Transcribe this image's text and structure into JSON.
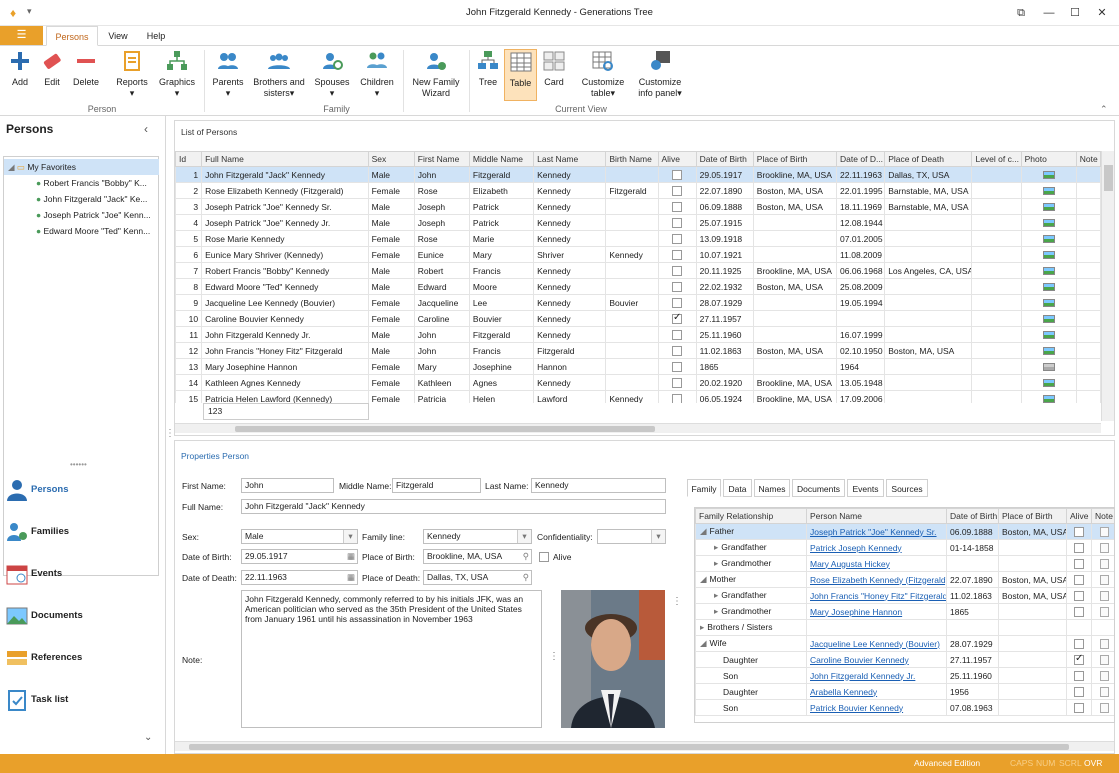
{
  "window": {
    "title": "John Fitzgerald Kennedy - Generations Tree"
  },
  "ribbon_tabs": [
    "Persons",
    "View",
    "Help"
  ],
  "ribbon": {
    "buttons": [
      {
        "label": "Add",
        "icon": "plus-icon"
      },
      {
        "label": "Edit",
        "icon": "eraser-icon"
      },
      {
        "label": "Delete",
        "icon": "minus-icon"
      },
      {
        "label": "Reports",
        "icon": "report-icon"
      },
      {
        "label": "Graphics",
        "icon": "graphics-icon"
      },
      {
        "label": "Parents",
        "icon": "parents-icon"
      },
      {
        "label": "Brothers and sisters",
        "icon": "siblings-icon"
      },
      {
        "label": "Spouses",
        "icon": "spouses-icon"
      },
      {
        "label": "Children",
        "icon": "children-icon"
      },
      {
        "label": "New Family Wizard",
        "icon": "wizard-icon"
      },
      {
        "label": "Tree",
        "icon": "tree-icon"
      },
      {
        "label": "Table",
        "icon": "table-icon"
      },
      {
        "label": "Card",
        "icon": "card-icon"
      },
      {
        "label": "Customize table",
        "icon": "customize-table-icon"
      },
      {
        "label": "Customize info panel",
        "icon": "customize-panel-icon"
      }
    ],
    "groups": [
      "Person",
      "Family",
      "Current View"
    ]
  },
  "left": {
    "title": "Persons",
    "favorites_label": "My Favorites",
    "favorites": [
      "Robert Francis \"Bobby\" K...",
      "John Fitzgerald \"Jack\" Ke...",
      "Joseph Patrick \"Joe\" Kenn...",
      "Edward Moore \"Ted\" Kenn..."
    ],
    "nav": [
      "Persons",
      "Families",
      "Events",
      "Documents",
      "References",
      "Task list"
    ]
  },
  "list": {
    "title": "List of Persons",
    "columns": [
      "Id",
      "Full Name",
      "Sex",
      "First Name",
      "Middle Name",
      "Last Name",
      "Birth Name",
      "Alive",
      "Date of Birth",
      "Place of Birth",
      "Date of D...",
      "Place of Death",
      "Level of c...",
      "Photo",
      "Note"
    ],
    "rows": [
      [
        "1",
        "John Fitzgerald \"Jack\" Kennedy",
        "Male",
        "John",
        "Fitzgerald",
        "Kennedy",
        "",
        false,
        "29.05.1917",
        "Brookline, MA, USA",
        "22.11.1963",
        "Dallas, TX, USA",
        "",
        true
      ],
      [
        "2",
        "Rose Elizabeth Kennedy (Fitzgerald)",
        "Female",
        "Rose",
        "Elizabeth",
        "Kennedy",
        "Fitzgerald",
        false,
        "22.07.1890",
        "Boston, MA, USA",
        "22.01.1995",
        "Barnstable, MA, USA",
        "",
        true
      ],
      [
        "3",
        "Joseph Patrick \"Joe\" Kennedy Sr.",
        "Male",
        "Joseph",
        "Patrick",
        "Kennedy",
        "",
        false,
        "06.09.1888",
        "Boston, MA, USA",
        "18.11.1969",
        "Barnstable, MA, USA",
        "",
        true
      ],
      [
        "4",
        "Joseph Patrick \"Joe\" Kennedy Jr.",
        "Male",
        "Joseph",
        "Patrick",
        "Kennedy",
        "",
        false,
        "25.07.1915",
        "",
        "12.08.1944",
        "",
        "",
        true
      ],
      [
        "5",
        "Rose Marie Kennedy",
        "Female",
        "Rose",
        "Marie",
        "Kennedy",
        "",
        false,
        "13.09.1918",
        "",
        "07.01.2005",
        "",
        "",
        true
      ],
      [
        "6",
        "Eunice Mary Shriver (Kennedy)",
        "Female",
        "Eunice",
        "Mary",
        "Shriver",
        "Kennedy",
        false,
        "10.07.1921",
        "",
        "11.08.2009",
        "",
        "",
        true
      ],
      [
        "7",
        "Robert Francis \"Bobby\" Kennedy",
        "Male",
        "Robert",
        "Francis",
        "Kennedy",
        "",
        false,
        "20.11.1925",
        "Brookline, MA, USA",
        "06.06.1968",
        "Los Angeles, CA, USA",
        "",
        true
      ],
      [
        "8",
        "Edward Moore \"Ted\" Kennedy",
        "Male",
        "Edward",
        "Moore",
        "Kennedy",
        "",
        false,
        "22.02.1932",
        "Boston, MA, USA",
        "25.08.2009",
        "",
        "",
        true
      ],
      [
        "9",
        "Jacqueline Lee Kennedy (Bouvier)",
        "Female",
        "Jacqueline",
        "Lee",
        "Kennedy",
        "Bouvier",
        false,
        "28.07.1929",
        "",
        "19.05.1994",
        "",
        "",
        true
      ],
      [
        "10",
        "Caroline Bouvier Kennedy",
        "Female",
        "Caroline",
        "Bouvier",
        "Kennedy",
        "",
        true,
        "27.11.1957",
        "",
        "",
        "",
        "",
        true
      ],
      [
        "11",
        "John Fitzgerald Kennedy Jr.",
        "Male",
        "John",
        "Fitzgerald",
        "Kennedy",
        "",
        false,
        "25.11.1960",
        "",
        "16.07.1999",
        "",
        "",
        true
      ],
      [
        "12",
        "John Francis \"Honey Fitz\" Fitzgerald",
        "Male",
        "John",
        "Francis",
        "Fitzgerald",
        "",
        false,
        "11.02.1863",
        "Boston, MA, USA",
        "02.10.1950",
        "Boston, MA, USA",
        "",
        true
      ],
      [
        "13",
        "Mary Josephine Hannon",
        "Female",
        "Mary",
        "Josephine",
        "Hannon",
        "",
        false,
        "1865",
        "",
        "1964",
        "",
        "",
        false
      ],
      [
        "14",
        "Kathleen Agnes Kennedy",
        "Female",
        "Kathleen",
        "Agnes",
        "Kennedy",
        "",
        false,
        "20.02.1920",
        "Brookline, MA, USA",
        "13.05.1948",
        "",
        "",
        true
      ],
      [
        "15",
        "Patricia Helen Lawford (Kennedy)",
        "Female",
        "Patricia",
        "Helen",
        "Lawford",
        "Kennedy",
        false,
        "06.05.1924",
        "Brookline, MA, USA",
        "17.09.2006",
        "",
        "",
        true
      ]
    ],
    "footer_count": "123"
  },
  "props": {
    "title": "Properties Person",
    "first_name_label": "First Name:",
    "first_name": "John",
    "middle_name_label": "Middle Name:",
    "middle_name": "Fitzgerald",
    "last_name_label": "Last Name:",
    "last_name": "Kennedy",
    "full_name_label": "Full Name:",
    "full_name": "John Fitzgerald \"Jack\" Kennedy",
    "sex_label": "Sex:",
    "sex": "Male",
    "family_line_label": "Family line:",
    "family_line": "Kennedy",
    "confidentiality_label": "Confidentiality:",
    "confidentiality": "",
    "dob_label": "Date of Birth:",
    "dob": "29.05.1917",
    "pob_label": "Place of Birth:",
    "pob": "Brookline, MA, USA",
    "alive_label": "Alive",
    "dod_label": "Date of Death:",
    "dod": "22.11.1963",
    "pod_label": "Place of Death:",
    "pod": "Dallas, TX, USA",
    "note_label": "Note:",
    "note": "John Fitzgerald Kennedy, commonly referred to by his initials JFK, was an American politician who served as the 35th President of the United States from January 1961 until his assassination in November 1963"
  },
  "family": {
    "tabs": [
      "Family",
      "Data",
      "Names",
      "Documents",
      "Events",
      "Sources"
    ],
    "columns": [
      "Family Relationship",
      "Person Name",
      "Date of Birth",
      "Place of Birth",
      "Alive",
      "Note"
    ],
    "rows": [
      {
        "rel": "Father",
        "name": "Joseph Patrick \"Joe\" Kennedy Sr.",
        "dob": "06.09.1888",
        "pob": "Boston, MA, USA",
        "alive": false,
        "sel": true
      },
      {
        "rel": "Grandfather",
        "name": "Patrick Joseph Kennedy",
        "dob": "01-14-1858",
        "pob": "",
        "alive": false
      },
      {
        "rel": "Grandmother",
        "name": "Mary Augusta Hickey",
        "dob": "",
        "pob": "",
        "alive": false
      },
      {
        "rel": "Mother",
        "name": "Rose Elizabeth Kennedy (Fitzgerald)",
        "dob": "22.07.1890",
        "pob": "Boston, MA, USA",
        "alive": false
      },
      {
        "rel": "Grandfather",
        "name": "John Francis \"Honey Fitz\" Fitzgerald",
        "dob": "11.02.1863",
        "pob": "Boston, MA, USA",
        "alive": false
      },
      {
        "rel": "Grandmother",
        "name": "Mary Josephine Hannon",
        "dob": "1865",
        "pob": "",
        "alive": false
      },
      {
        "rel": "Brothers / Sisters",
        "name": "",
        "dob": "",
        "pob": "",
        "alive": null
      },
      {
        "rel": "Wife",
        "name": "Jacqueline Lee Kennedy  (Bouvier)",
        "dob": "28.07.1929",
        "pob": "",
        "alive": false
      },
      {
        "rel": "Daughter",
        "name": "Caroline Bouvier Kennedy",
        "dob": "27.11.1957",
        "pob": "",
        "alive": true
      },
      {
        "rel": "Son",
        "name": "John Fitzgerald Kennedy Jr.",
        "dob": "25.11.1960",
        "pob": "",
        "alive": false
      },
      {
        "rel": "Daughter",
        "name": "Arabella Kennedy",
        "dob": "1956",
        "pob": "",
        "alive": false
      },
      {
        "rel": "Son",
        "name": "Patrick Bouvier Kennedy",
        "dob": "07.08.1963",
        "pob": "",
        "alive": false
      }
    ]
  },
  "status": {
    "edition": "Advanced Edition",
    "indicators": [
      "CAPS",
      "NUM",
      "SCRL",
      "OVR"
    ]
  },
  "colors": {
    "accent": "#e9a02a",
    "selection": "#cfe3f7",
    "link": "#1a5fb4"
  }
}
